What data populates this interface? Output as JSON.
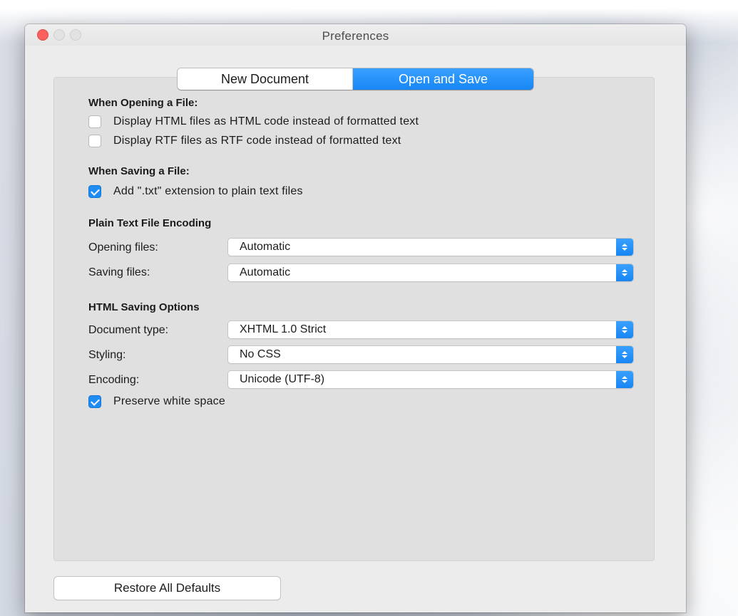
{
  "window": {
    "title": "Preferences"
  },
  "tabs": [
    {
      "label": "New Document",
      "active": false
    },
    {
      "label": "Open and Save",
      "active": true
    }
  ],
  "opening": {
    "heading": "When Opening a File:",
    "options": [
      {
        "label": "Display HTML files as HTML code instead of formatted text",
        "checked": false
      },
      {
        "label": "Display RTF files as RTF code instead of formatted text",
        "checked": false
      }
    ]
  },
  "saving": {
    "heading": "When Saving a File:",
    "options": [
      {
        "label": "Add \".txt\" extension to plain text files",
        "checked": true
      }
    ]
  },
  "encoding": {
    "heading": "Plain Text File Encoding",
    "opening_label": "Opening files:",
    "opening_value": "Automatic",
    "saving_label": "Saving files:",
    "saving_value": "Automatic"
  },
  "html": {
    "heading": "HTML Saving Options",
    "doctype_label": "Document type:",
    "doctype_value": "XHTML 1.0 Strict",
    "styling_label": "Styling:",
    "styling_value": "No CSS",
    "encoding_label": "Encoding:",
    "encoding_value": "Unicode (UTF-8)",
    "preserve_label": "Preserve white space",
    "preserve_checked": true
  },
  "footer": {
    "restore_label": "Restore All Defaults"
  },
  "colors": {
    "accent": "#1f8cf4",
    "close": "#fc605c"
  }
}
